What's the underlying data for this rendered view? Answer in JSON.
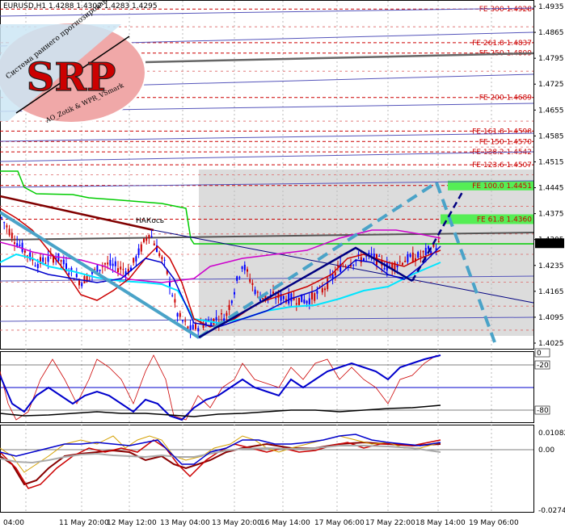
{
  "chart_data": {
    "type": "candlestick",
    "header": {
      "symbol": "EURUSD,H1",
      "ohlc": "1.4288 1.4302 1.4283 1.4295"
    },
    "logo": {
      "letters": "SRP",
      "arc_top": "Система раннего прогнозирования",
      "arc_bottom": "AO_Zotik & WPR_VSmark"
    },
    "annotation": "НАКось",
    "price_axis": [
      "1.4935",
      "1.4865",
      "1.4795",
      "1.4725",
      "1.4655",
      "1.4585",
      "1.4515",
      "1.4445",
      "1.4375",
      "1.4305",
      "1.4235",
      "1.4165",
      "1.4095",
      "1.4025"
    ],
    "current_price": "1.4295",
    "fib_levels": [
      {
        "label": "FE 300 1.4928",
        "price": 1.4928,
        "boxed": false
      },
      {
        "label": "FE 261.8 1.4837",
        "price": 1.4837,
        "boxed": false
      },
      {
        "label": "FE 250 1.4809",
        "price": 1.4809,
        "boxed": false
      },
      {
        "label": "FE 200 1.4689",
        "price": 1.4689,
        "boxed": false
      },
      {
        "label": "FE 161.8 1.4598",
        "price": 1.4598,
        "boxed": false
      },
      {
        "label": "FE 150 1.4570",
        "price": 1.457,
        "boxed": false
      },
      {
        "label": "FE 138.2 1.4542",
        "price": 1.4542,
        "boxed": false
      },
      {
        "label": "FE 123.6 1.4507",
        "price": 1.4507,
        "boxed": false
      },
      {
        "label": "FE 100.0 1.4451",
        "price": 1.4451,
        "boxed": true
      },
      {
        "label": "FE 61.8 1.4360",
        "price": 1.436,
        "boxed": true
      }
    ],
    "time_axis": [
      "04:00",
      "11 May 20:00",
      "12 May 12:00",
      "13 May 04:00",
      "13 May 20:00",
      "16 May 14:00",
      "17 May 06:00",
      "17 May 22:00",
      "18 May 14:00",
      "19 May 06:00"
    ],
    "wpr_panel": {
      "labels": [
        "0",
        "-20",
        "-80"
      ]
    },
    "ao_panel": {
      "labels": [
        "0.01082",
        "0.00",
        "-0.02745"
      ]
    },
    "colors": {
      "bull_candle": "#0000ff",
      "bear_candle": "#cc0000",
      "fib": "#cc0000",
      "blue_line": "#0000cc",
      "red_ma": "#cc0000",
      "magenta_ma": "#cc00cc",
      "cyan_ma": "#00e5ff",
      "green_line": "#00cc00",
      "pattern": "#4aa3c8",
      "navy": "#000080",
      "box_green": "#55ee55"
    }
  }
}
